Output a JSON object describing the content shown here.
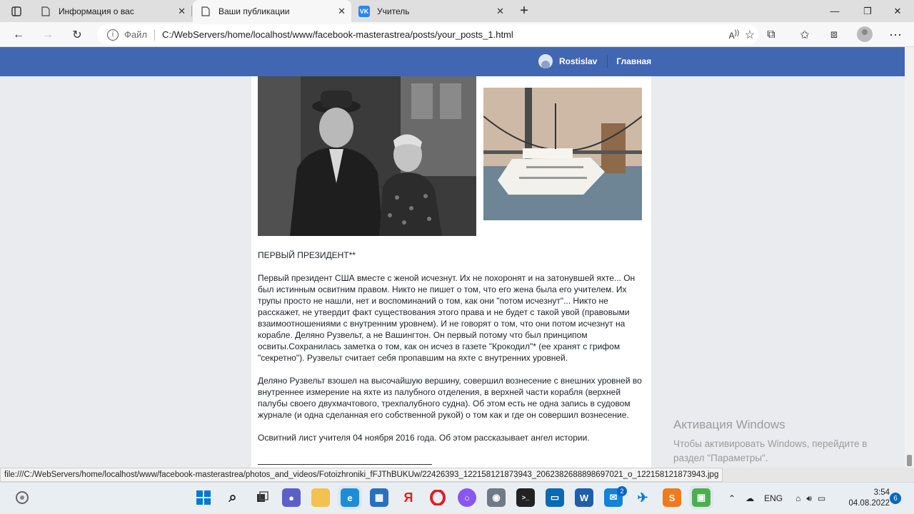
{
  "browser": {
    "tabs": [
      {
        "label": "Информация о вас"
      },
      {
        "label": "Ваши публикации"
      },
      {
        "label": "Учитель",
        "icon_text": "VK"
      }
    ],
    "address": {
      "scheme_label": "Файл",
      "url": "C:/WebServers/home/localhost/www/facebook-masterastrea/posts/your_posts_1.html"
    },
    "status_url": "file:///C:/WebServers/home/localhost/www/facebook-masterastrea/photos_and_videos/Fotoizhroniki_fFJThBUKUw/22426393_122158121873943_2062382688898697021_o_122158121873943.jpg"
  },
  "facebook": {
    "user_name": "Rostislav",
    "home_label": "Главная",
    "brand_color": "#4267b2"
  },
  "post": {
    "title": "ПЕРВЫЙ ПРЕЗИДЕНТ**",
    "paragraphs": [
      "Первый президент США вместе с женой исчезнут. Их не похоронят и на затонувшей яхте... Он был истинным освитним правом. Никто не пишет о том, что его жена была его учителем. Их трупы просто не нашли, нет и воспоминаний о том, как они \"потом исчезнут\"... Никто не расскажет, не утвердит факт существования этого права и не будет с такой увой (правовыми взаимоотношениями с внутренним уровнем). И не говорят о том, что они потом исчезнут на корабле. Деляно Рузвельт, а не Вашингтон. Он первый потому что был принципом освиты.Сохранилась заметка о том, как он исчез в газете \"Крокодил\"* (ее хранят с грифом \"секретно\"). Рузвельт считает себя пропавшим на яхте с внутренних уровней.",
      "Деляно Рузвельт взошел на высочайшую вершину, совершил вознесение с внешних уровней во внутреннее измерение на яхте из палубного отделения, в верхней части корабля (верхней палубы своего двухмачтового, трехпалубного судна). Об этом есть не одна запись в судовом журнале (и одна сделанная его собственной рукой) о том как и где он совершил вознесение.",
      "Освитний лист учителя 04 ноября 2016 года. Об этом рассказывает ангел истории."
    ]
  },
  "windows": {
    "activation_title": "Активация Windows",
    "activation_line1": "Чтобы активировать Windows, перейдите в",
    "activation_line2": "раздел \"Параметры\".",
    "language": "ENG",
    "time": "3:54",
    "date": "04.08.2022",
    "notifications": "6",
    "mail_badge": "2"
  }
}
